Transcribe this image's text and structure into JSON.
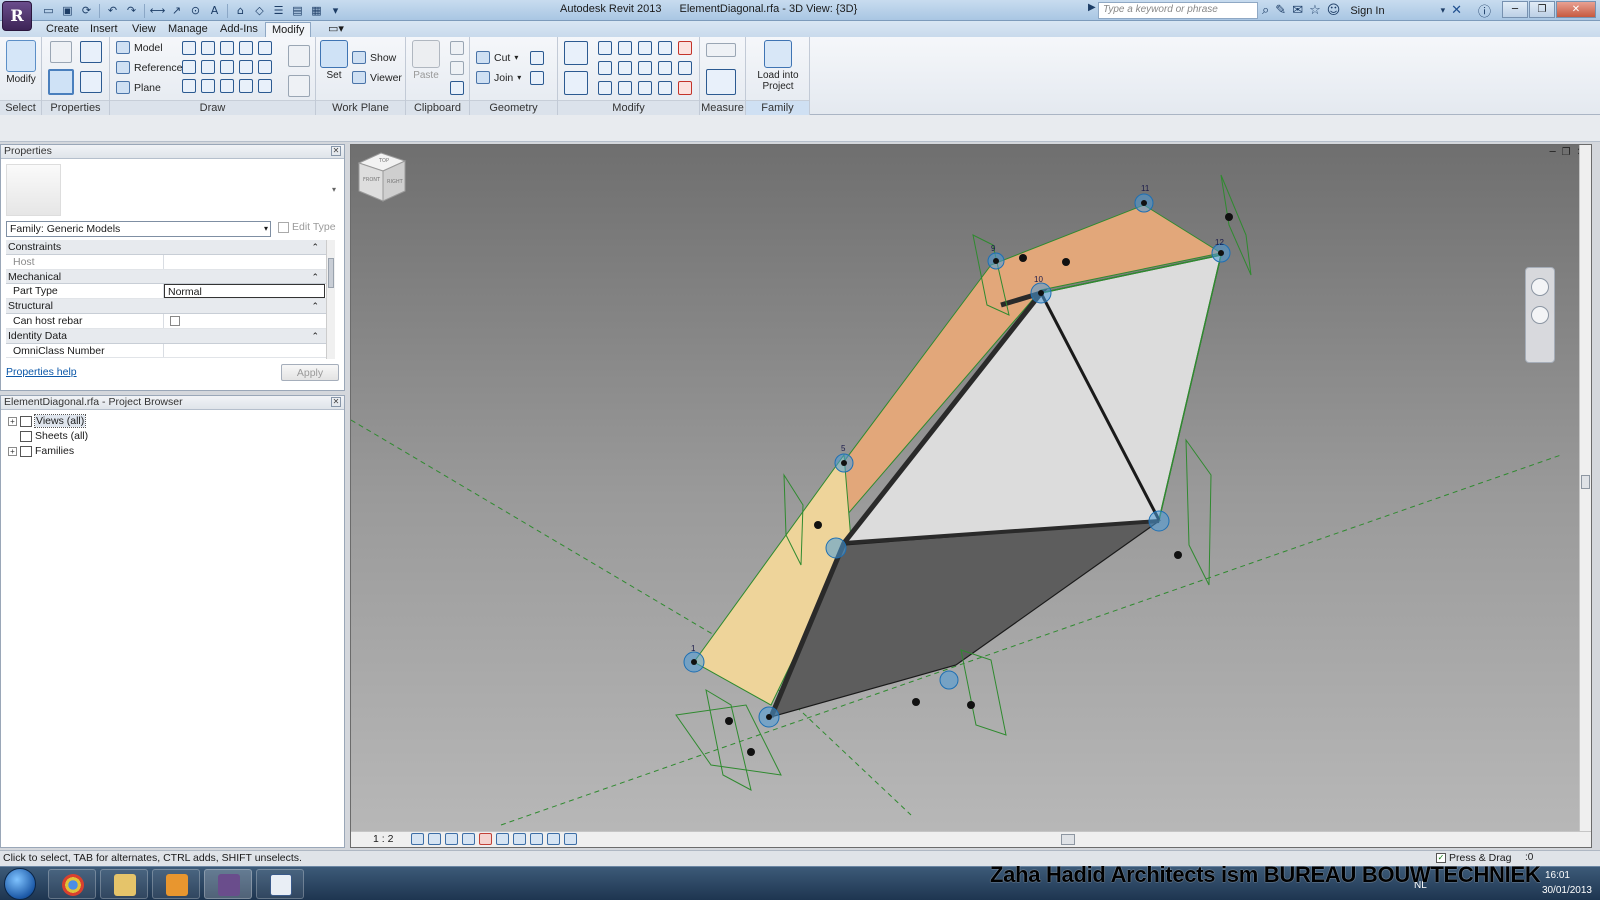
{
  "titlebar": {
    "app": "Autodesk Revit 2013",
    "document": "ElementDiagonal.rfa - 3D View: {3D}",
    "search_placeholder": "Type a keyword or phrase",
    "sign_in": "Sign In"
  },
  "tabs": [
    "Create",
    "Insert",
    "View",
    "Manage",
    "Add-Ins",
    "Modify"
  ],
  "active_tab": "Modify",
  "ribbon": {
    "select": {
      "label": "Select",
      "modify": "Modify"
    },
    "properties": {
      "label": "Properties"
    },
    "draw": {
      "label": "Draw",
      "model": "Model",
      "reference": "Reference",
      "plane": "Plane"
    },
    "work_plane": {
      "label": "Work Plane",
      "set": "Set",
      "show": "Show",
      "viewer": "Viewer"
    },
    "clipboard": {
      "label": "Clipboard",
      "paste": "Paste"
    },
    "geometry": {
      "label": "Geometry",
      "cut": "Cut",
      "join": "Join"
    },
    "modify": {
      "label": "Modify"
    },
    "measure": {
      "label": "Measure"
    },
    "family_editor": {
      "label": "Family Editor",
      "load_line1": "Load into",
      "load_line2": "Project"
    }
  },
  "properties_panel": {
    "title": "Properties",
    "family_select": "Family: Generic Models",
    "edit_type": "Edit Type",
    "categories": [
      {
        "name": "Constraints",
        "rows": [
          {
            "key": "Host",
            "value": "",
            "dim": true
          }
        ]
      },
      {
        "name": "Mechanical",
        "rows": [
          {
            "key": "Part Type",
            "value": "Normal",
            "dim": false
          }
        ]
      },
      {
        "name": "Structural",
        "rows": [
          {
            "key": "Can host rebar",
            "value": "",
            "dim": false
          }
        ]
      },
      {
        "name": "Identity Data",
        "rows": [
          {
            "key": "OmniClass Number",
            "value": "",
            "dim": false
          }
        ]
      }
    ],
    "help": "Properties help",
    "apply": "Apply"
  },
  "project_browser": {
    "title": "ElementDiagonal.rfa - Project Browser",
    "items": [
      "Views (all)",
      "Sheets (all)",
      "Families"
    ]
  },
  "viewport": {
    "scale": "1 : 2",
    "viewcube": {
      "top": "TOP",
      "front": "FRONT",
      "right": "RIGHT"
    },
    "node_labels": [
      "11",
      "12",
      "9",
      "10",
      "5",
      "1"
    ]
  },
  "statusbar": {
    "text": "Click to select, TAB for alternates, CTRL adds, SHIFT unselects.",
    "press_drag": "Press & Drag",
    "filter_count": ":0"
  },
  "taskbar": {
    "watermark": "Zaha Hadid Architects ism BUREAU BOUWTECHNIEK",
    "lang": "NL",
    "date": "30/01/2013",
    "time": "16:01"
  },
  "colors": {
    "accent": "#2c5a91",
    "panel_orange": "#e2a77a",
    "panel_yellow": "#eed49a",
    "face_light": "#dcdcdc",
    "face_dark": "#5d5d5d",
    "ref_green": "#2f8a2f",
    "node_blue": "#4a9ad8"
  }
}
